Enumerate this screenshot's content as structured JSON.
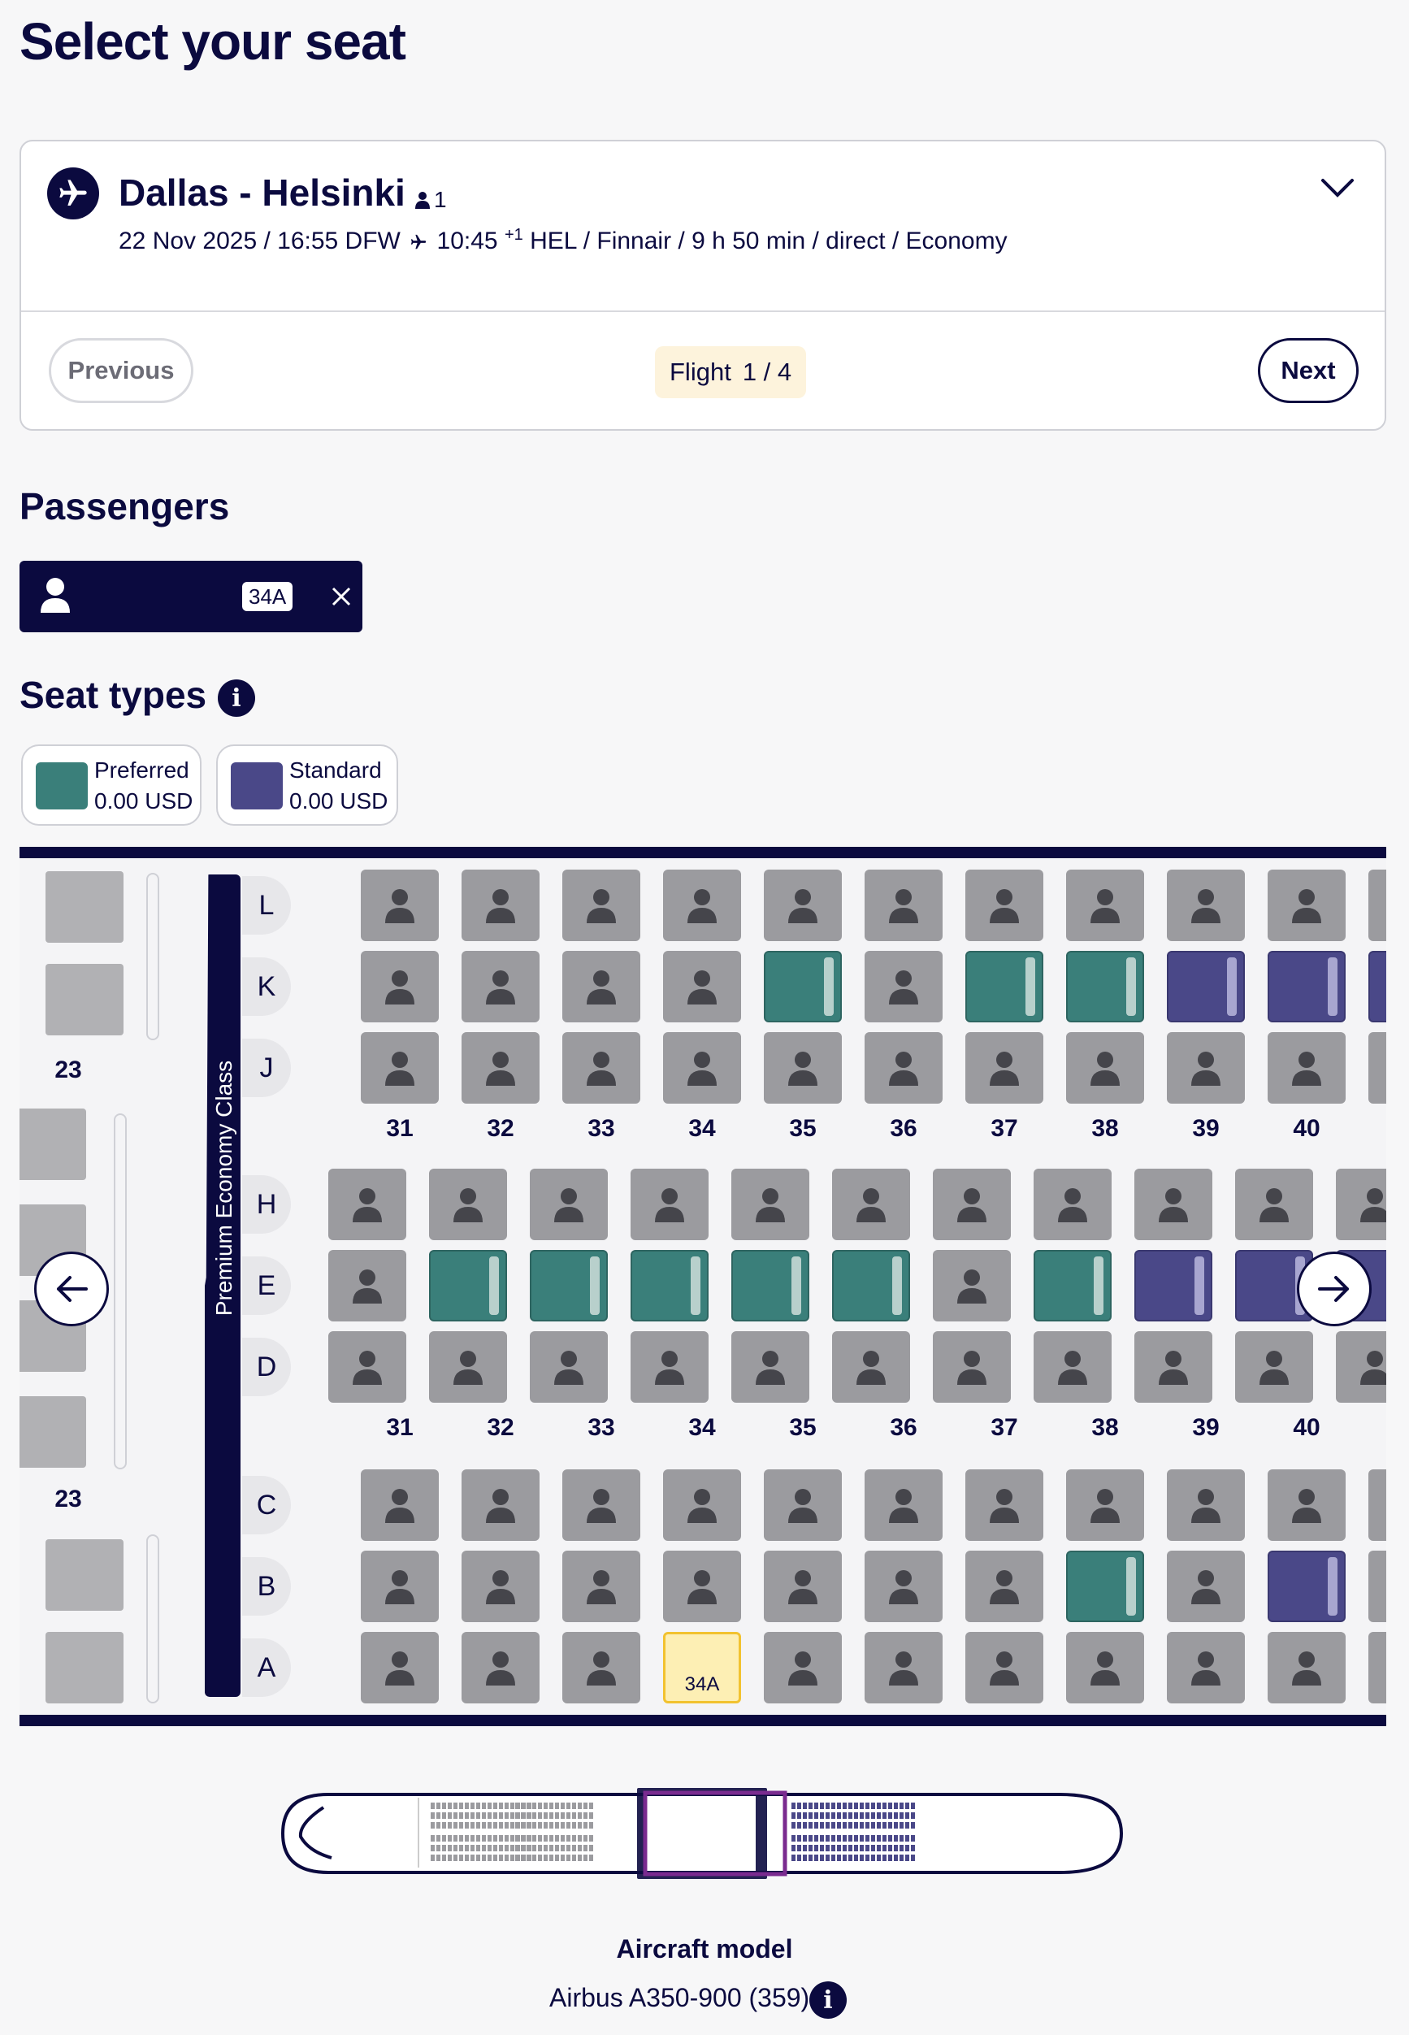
{
  "page": {
    "title": "Select your seat"
  },
  "flight": {
    "route": "Dallas - Helsinki",
    "passenger_count": "1",
    "details_pre": "22 Nov 2025 / 16:55 DFW",
    "details_time": "10:45",
    "details_sup": "+1",
    "details_post": "HEL / Finnair / 9 h 50 min / direct / Economy",
    "flight_label": "Flight",
    "flight_index": "1 / 4",
    "previous_label": "Previous",
    "next_label": "Next"
  },
  "passengers": {
    "title": "Passengers",
    "selected_seat": "34A"
  },
  "seat_types": {
    "title": "Seat types",
    "items": [
      {
        "name": "Preferred",
        "price": "0.00 USD",
        "color": "#3a7f7a"
      },
      {
        "name": "Standard",
        "price": "0.00 USD",
        "color": "#4a4888"
      }
    ]
  },
  "seat_map": {
    "cabin_label": "Premium Economy Class",
    "front_row_label": "23",
    "row_numbers": [
      "31",
      "32",
      "33",
      "34",
      "35",
      "36",
      "37",
      "38",
      "39",
      "40"
    ],
    "columns": [
      "L",
      "K",
      "J",
      "H",
      "E",
      "D",
      "C",
      "B",
      "A"
    ],
    "seats": {
      "L": [
        "o",
        "o",
        "o",
        "o",
        "o",
        "o",
        "o",
        "o",
        "o",
        "o"
      ],
      "K": [
        "o",
        "o",
        "o",
        "o",
        "p",
        "o",
        "p",
        "p",
        "s",
        "s"
      ],
      "J": [
        "o",
        "o",
        "o",
        "o",
        "o",
        "o",
        "o",
        "o",
        "o",
        "o"
      ],
      "H": [
        "o",
        "o",
        "o",
        "o",
        "o",
        "o",
        "o",
        "o",
        "o",
        "o"
      ],
      "E": [
        "o",
        "p",
        "p",
        "p",
        "p",
        "p",
        "o",
        "p",
        "s",
        "s"
      ],
      "D": [
        "o",
        "o",
        "o",
        "o",
        "o",
        "o",
        "o",
        "o",
        "o",
        "o"
      ],
      "C": [
        "o",
        "o",
        "o",
        "o",
        "o",
        "o",
        "o",
        "o",
        "o",
        "o"
      ],
      "B": [
        "o",
        "o",
        "o",
        "o",
        "o",
        "o",
        "o",
        "p",
        "o",
        "s"
      ],
      "A": [
        "o",
        "o",
        "o",
        "sel",
        "o",
        "o",
        "o",
        "o",
        "o",
        "o"
      ]
    },
    "selected_label": "34A"
  },
  "aircraft": {
    "title": "Aircraft model",
    "model": "Airbus A350-900 (359)"
  },
  "colors": {
    "navy": "#0b0a3f",
    "preferred": "#3a7f7a",
    "standard": "#4a4888",
    "occupied": "#9b9b9f",
    "selected": "#fdefb4"
  }
}
